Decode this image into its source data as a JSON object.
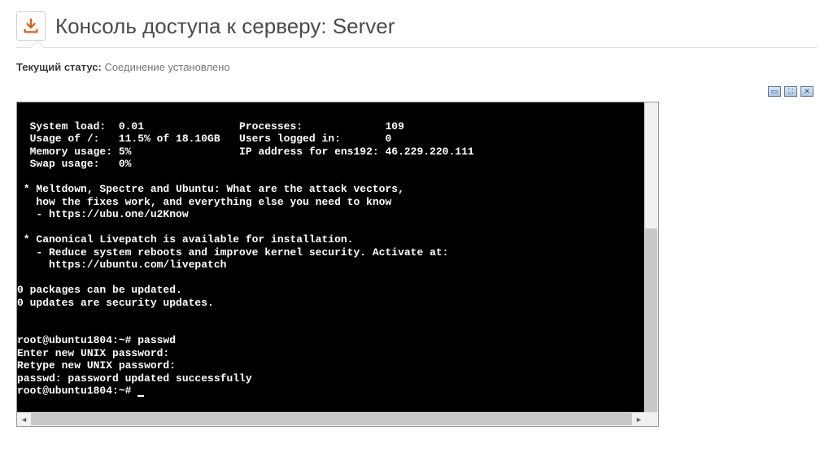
{
  "header": {
    "title": "Консоль доступа к серверу: Server"
  },
  "status": {
    "label": "Текущий статус:",
    "value": "Соединение установлено"
  },
  "toolbar": {
    "icon1": "window-restore-icon",
    "icon2": "fullscreen-icon",
    "icon3": "expand-icon"
  },
  "console": {
    "lines": [
      "",
      "  System load:  0.01               Processes:             109",
      "  Usage of /:   11.5% of 18.10GB   Users logged in:       0",
      "  Memory usage: 5%                 IP address for ens192: 46.229.220.111",
      "  Swap usage:   0%",
      "",
      " * Meltdown, Spectre and Ubuntu: What are the attack vectors,",
      "   how the fixes work, and everything else you need to know",
      "   - https://ubu.one/u2Know",
      "",
      " * Canonical Livepatch is available for installation.",
      "   - Reduce system reboots and improve kernel security. Activate at:",
      "     https://ubuntu.com/livepatch",
      "",
      "0 packages can be updated.",
      "0 updates are security updates.",
      "",
      "",
      "root@ubuntu1804:~# passwd",
      "Enter new UNIX password:",
      "Retype new UNIX password:",
      "passwd: password updated successfully",
      "root@ubuntu1804:~# "
    ]
  }
}
